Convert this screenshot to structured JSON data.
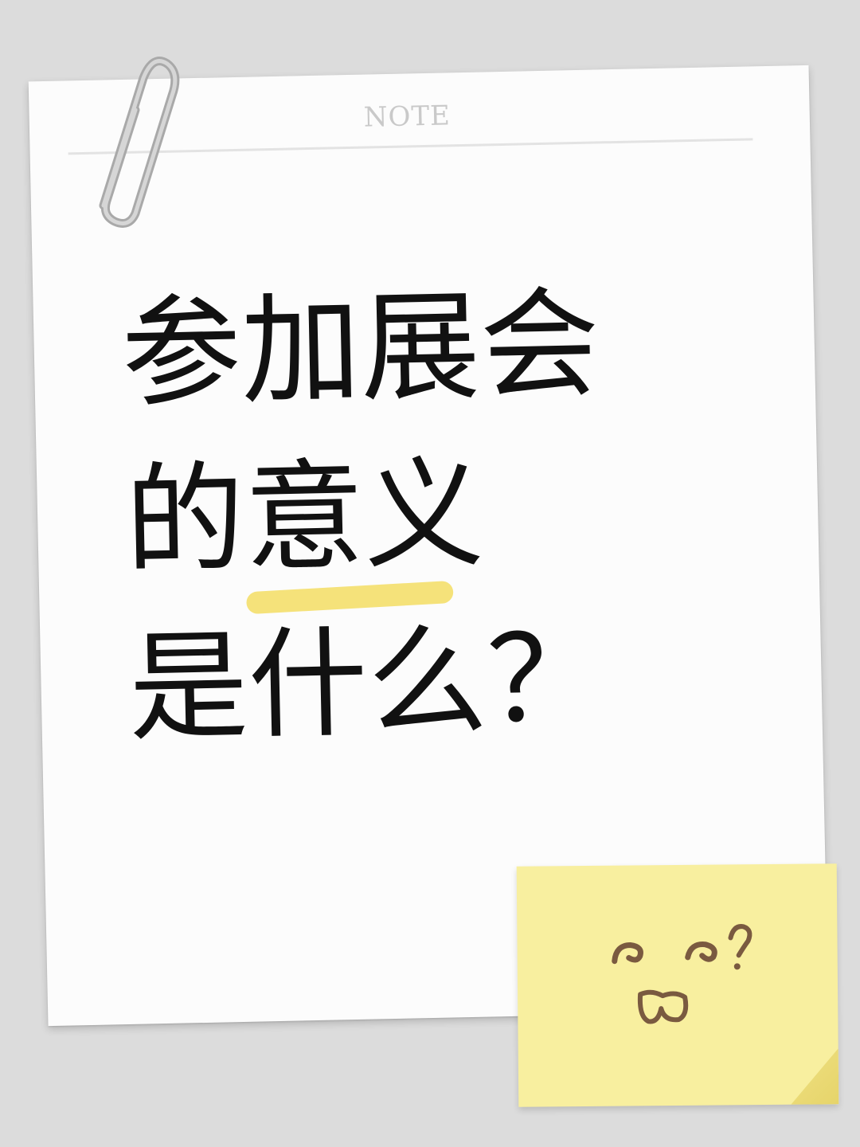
{
  "note": {
    "label": "NOTE",
    "headline_line1": "参加展会",
    "headline_line2_a": "的",
    "headline_line2_b": "意义",
    "headline_line3": "是什么？"
  },
  "colors": {
    "background": "#dcdcdc",
    "paper": "#fcfcfc",
    "highlight": "#f5e27a",
    "sticky_note": "#f8ef9f",
    "doodle_ink": "#7a5a40"
  },
  "icons": {
    "clip": "paperclip-icon",
    "doodle": "confused-face-doodle"
  }
}
